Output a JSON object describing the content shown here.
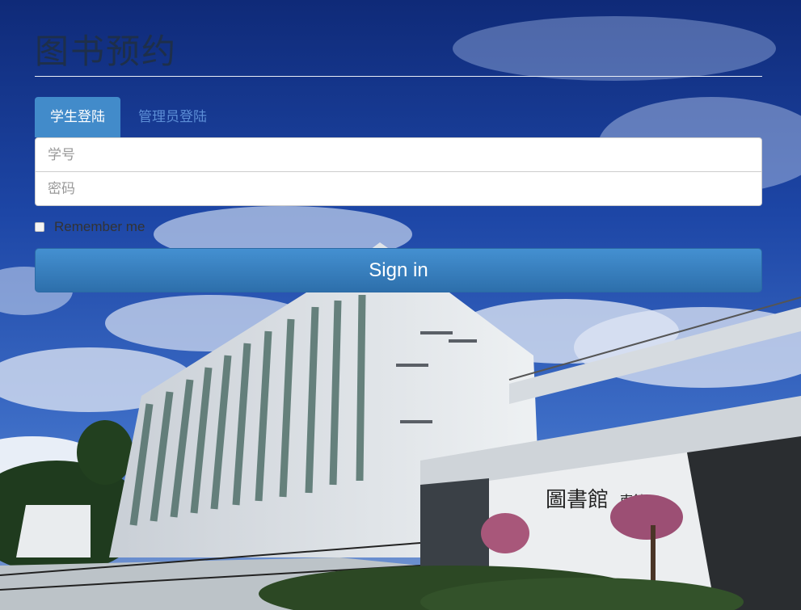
{
  "page": {
    "title": "图书预约"
  },
  "tabs": [
    {
      "label": "学生登陆",
      "active": true
    },
    {
      "label": "管理员登陆",
      "active": false
    }
  ],
  "form": {
    "student_id_placeholder": "学号",
    "password_placeholder": "密码",
    "remember_label": "Remember me",
    "submit_label": "Sign in"
  },
  "colors": {
    "tab_active": "#428bca",
    "tab_inactive_text": "#5c8ed6",
    "button": "#337ab7",
    "sky": "#1d3f96"
  },
  "background": {
    "building_sign": "图書館 南館"
  }
}
